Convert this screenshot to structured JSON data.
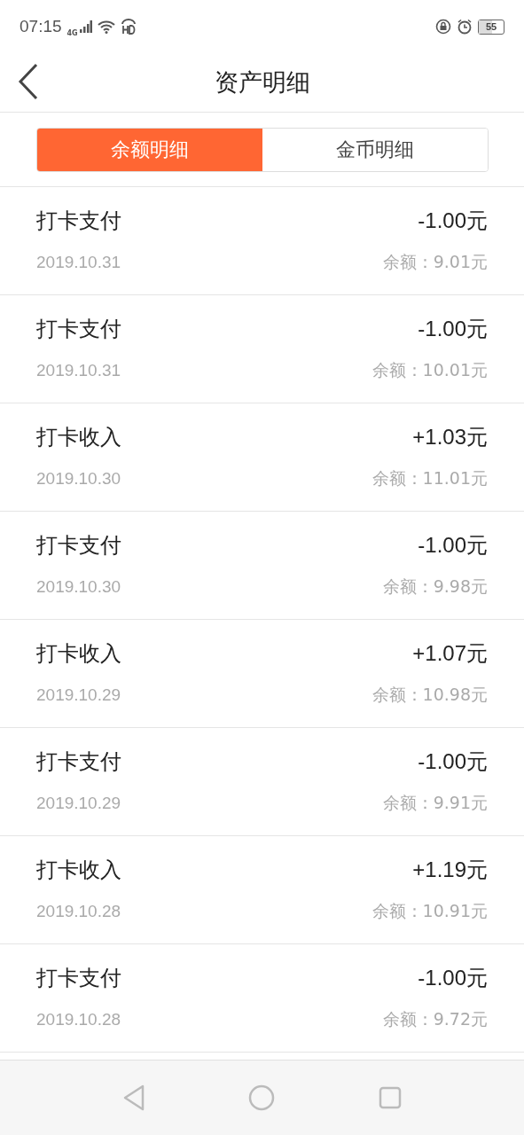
{
  "status_bar": {
    "time": "07:15",
    "network": "4G",
    "battery": "55"
  },
  "header": {
    "title": "资产明细"
  },
  "tabs": [
    {
      "label": "余额明细",
      "selected": true
    },
    {
      "label": "金币明细",
      "selected": false
    }
  ],
  "records": [
    {
      "title": "打卡支付",
      "amount": "-1.00元",
      "date": "2019.10.31",
      "balance": "余额：9.01元"
    },
    {
      "title": "打卡支付",
      "amount": "-1.00元",
      "date": "2019.10.31",
      "balance": "余额：10.01元"
    },
    {
      "title": "打卡收入",
      "amount": "+1.03元",
      "date": "2019.10.30",
      "balance": "余额：11.01元"
    },
    {
      "title": "打卡支付",
      "amount": "-1.00元",
      "date": "2019.10.30",
      "balance": "余额：9.98元"
    },
    {
      "title": "打卡收入",
      "amount": "+1.07元",
      "date": "2019.10.29",
      "balance": "余额：10.98元"
    },
    {
      "title": "打卡支付",
      "amount": "-1.00元",
      "date": "2019.10.29",
      "balance": "余额：9.91元"
    },
    {
      "title": "打卡收入",
      "amount": "+1.19元",
      "date": "2019.10.28",
      "balance": "余额：10.91元"
    },
    {
      "title": "打卡支付",
      "amount": "-1.00元",
      "date": "2019.10.28",
      "balance": "余额：9.72元"
    }
  ]
}
